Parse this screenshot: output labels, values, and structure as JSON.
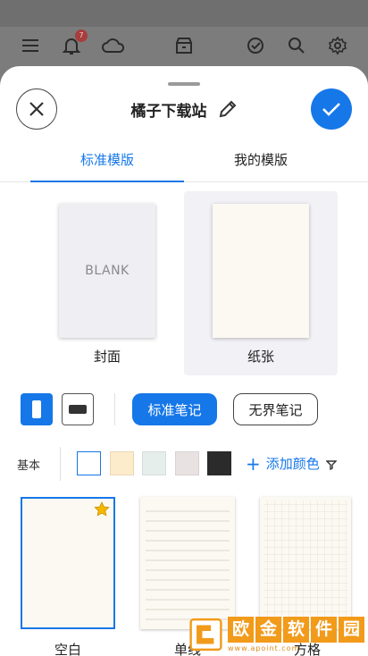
{
  "app_bar": {
    "notification_count": "7"
  },
  "sheet": {
    "title": "橘子下载站"
  },
  "tabs": [
    {
      "label": "标准模版",
      "active": true
    },
    {
      "label": "我的模版",
      "active": false
    }
  ],
  "templates": {
    "cover": {
      "label": "封面",
      "preview_text": "BLANK"
    },
    "paper": {
      "label": "纸张",
      "selected": true
    }
  },
  "options": {
    "standard_notes_label": "标准笔记",
    "infinite_notes_label": "无界笔记"
  },
  "colors": {
    "basic_label": "基本",
    "swatches": [
      "#ffffff",
      "#fdeccc",
      "#e6eeec",
      "#e8e2e2",
      "#2b2b2b"
    ],
    "add_color_label": "添加颜色",
    "accent": "#1677e8"
  },
  "papers": [
    {
      "label": "空白",
      "selected": true
    },
    {
      "label": "单线"
    },
    {
      "label": "方格"
    }
  ],
  "watermark": {
    "text": "欧金软件园",
    "url": "www.apoint.com"
  }
}
